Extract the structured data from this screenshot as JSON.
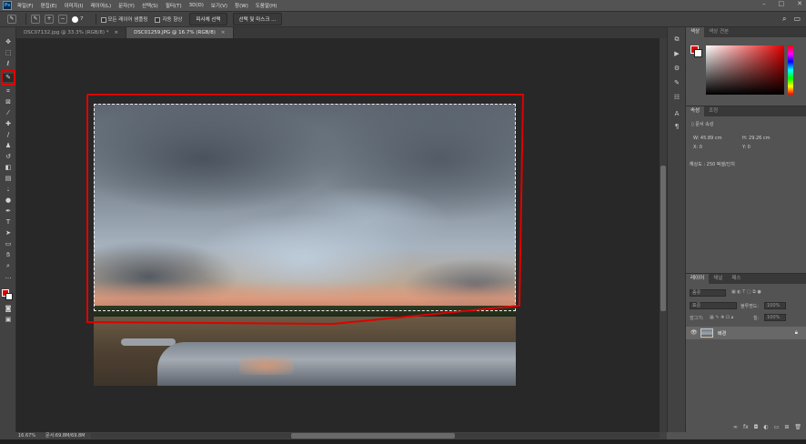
{
  "menu": [
    "파일(F)",
    "편집(E)",
    "이미지(I)",
    "레이어(L)",
    "문자(Y)",
    "선택(S)",
    "필터(T)",
    "3D(D)",
    "보기(V)",
    "창(W)",
    "도움말(H)"
  ],
  "options": {
    "brush_size": "7",
    "sample_all_layers": "모든 레이어 샘플링",
    "auto_enhance": "자동 향상",
    "select_subject": "피사체 선택",
    "select_and_mask": "선택 및 마스크 ..."
  },
  "tabs": [
    {
      "label": "DSC07132.jpg @ 33.3% (RGB/8) *",
      "active": false
    },
    {
      "label": "DSC01259.JPG @ 16.7% (RGB/8)",
      "active": true
    }
  ],
  "color_panel": {
    "tab_color": "색상",
    "tab_swatches": "색상 견본",
    "fg": "#e00000",
    "bg": "#ffffff"
  },
  "properties": {
    "tab_props": "속성",
    "tab_adjust": "조정",
    "doc_props": "문서 속성",
    "w": "W:  45.89 cm",
    "h": "H:  29.26 cm",
    "x": "X:  0",
    "y": "Y:  0",
    "resolution": "해상도 : 250 픽셀/인치"
  },
  "layers": {
    "tab_layers": "레이어",
    "tab_channels": "채널",
    "tab_paths": "패스",
    "kind": "종류",
    "blend": "표준",
    "opacity_label": "불투명도:",
    "opacity": "100%",
    "lock_label": "잠그기:",
    "fill_label": "칠:",
    "fill": "100%",
    "items": [
      {
        "name": "배경",
        "locked": true
      }
    ]
  },
  "status": {
    "zoom": "16.67%",
    "doc": "문서:69.8M/69.8M"
  }
}
